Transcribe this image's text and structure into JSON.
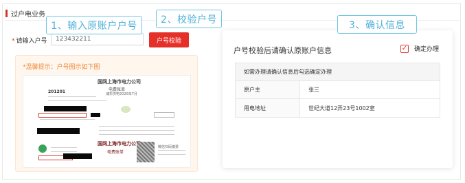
{
  "section": {
    "title": "过户电业务"
  },
  "steps": [
    "1、输入原账户户号",
    "2、校验户号",
    "3、确认信息"
  ],
  "form": {
    "label": "请输入户号",
    "required_mark": "*",
    "account_value": "123432211",
    "verify_button": "户号校验"
  },
  "tip": {
    "text": "*温馨提示：户号图示如下图"
  },
  "bill": {
    "company": "国网上海市电力公司",
    "doc": "电费账单",
    "account_no": "201201",
    "period": "浦东供电2020年7月",
    "company_2": "国网上海市电力公司",
    "doc_2": "电费账单",
    "wechat_label": "微信扫码缴费"
  },
  "confirm": {
    "title": "户号校验后请确认原账户信息",
    "checkbox_label": "确定办理",
    "checked": true,
    "table_header": "如需办理请确认信息后勾选确定办理",
    "rows": [
      {
        "key": "原户主",
        "value": "张三"
      },
      {
        "key": "用电地址",
        "value": "世纪大道12弄23号1002室"
      }
    ]
  },
  "colors": {
    "accent_red": "#e5302a",
    "step_blue": "#4fb0d8",
    "tip_orange": "#f08a3a"
  }
}
